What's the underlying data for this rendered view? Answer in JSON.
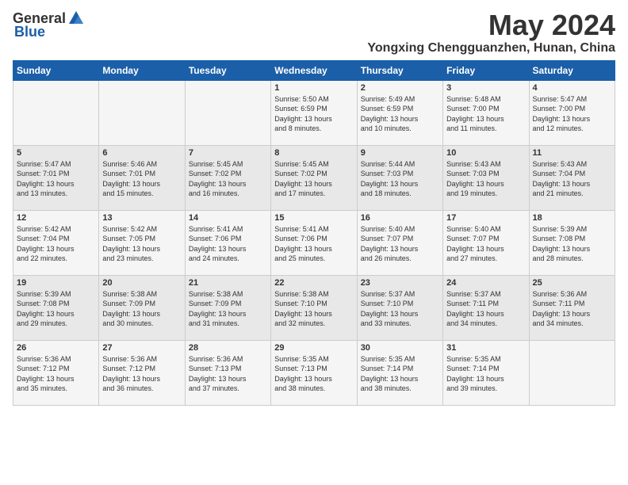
{
  "header": {
    "logo_general": "General",
    "logo_blue": "Blue",
    "month_year": "May 2024",
    "location": "Yongxing Chengguanzhen, Hunan, China"
  },
  "days_of_week": [
    "Sunday",
    "Monday",
    "Tuesday",
    "Wednesday",
    "Thursday",
    "Friday",
    "Saturday"
  ],
  "weeks": [
    {
      "cells": [
        {
          "day": "",
          "info": ""
        },
        {
          "day": "",
          "info": ""
        },
        {
          "day": "",
          "info": ""
        },
        {
          "day": "1",
          "info": "Sunrise: 5:50 AM\nSunset: 6:59 PM\nDaylight: 13 hours\nand 8 minutes."
        },
        {
          "day": "2",
          "info": "Sunrise: 5:49 AM\nSunset: 6:59 PM\nDaylight: 13 hours\nand 10 minutes."
        },
        {
          "day": "3",
          "info": "Sunrise: 5:48 AM\nSunset: 7:00 PM\nDaylight: 13 hours\nand 11 minutes."
        },
        {
          "day": "4",
          "info": "Sunrise: 5:47 AM\nSunset: 7:00 PM\nDaylight: 13 hours\nand 12 minutes."
        }
      ]
    },
    {
      "cells": [
        {
          "day": "5",
          "info": "Sunrise: 5:47 AM\nSunset: 7:01 PM\nDaylight: 13 hours\nand 13 minutes."
        },
        {
          "day": "6",
          "info": "Sunrise: 5:46 AM\nSunset: 7:01 PM\nDaylight: 13 hours\nand 15 minutes."
        },
        {
          "day": "7",
          "info": "Sunrise: 5:45 AM\nSunset: 7:02 PM\nDaylight: 13 hours\nand 16 minutes."
        },
        {
          "day": "8",
          "info": "Sunrise: 5:45 AM\nSunset: 7:02 PM\nDaylight: 13 hours\nand 17 minutes."
        },
        {
          "day": "9",
          "info": "Sunrise: 5:44 AM\nSunset: 7:03 PM\nDaylight: 13 hours\nand 18 minutes."
        },
        {
          "day": "10",
          "info": "Sunrise: 5:43 AM\nSunset: 7:03 PM\nDaylight: 13 hours\nand 19 minutes."
        },
        {
          "day": "11",
          "info": "Sunrise: 5:43 AM\nSunset: 7:04 PM\nDaylight: 13 hours\nand 21 minutes."
        }
      ]
    },
    {
      "cells": [
        {
          "day": "12",
          "info": "Sunrise: 5:42 AM\nSunset: 7:04 PM\nDaylight: 13 hours\nand 22 minutes."
        },
        {
          "day": "13",
          "info": "Sunrise: 5:42 AM\nSunset: 7:05 PM\nDaylight: 13 hours\nand 23 minutes."
        },
        {
          "day": "14",
          "info": "Sunrise: 5:41 AM\nSunset: 7:06 PM\nDaylight: 13 hours\nand 24 minutes."
        },
        {
          "day": "15",
          "info": "Sunrise: 5:41 AM\nSunset: 7:06 PM\nDaylight: 13 hours\nand 25 minutes."
        },
        {
          "day": "16",
          "info": "Sunrise: 5:40 AM\nSunset: 7:07 PM\nDaylight: 13 hours\nand 26 minutes."
        },
        {
          "day": "17",
          "info": "Sunrise: 5:40 AM\nSunset: 7:07 PM\nDaylight: 13 hours\nand 27 minutes."
        },
        {
          "day": "18",
          "info": "Sunrise: 5:39 AM\nSunset: 7:08 PM\nDaylight: 13 hours\nand 28 minutes."
        }
      ]
    },
    {
      "cells": [
        {
          "day": "19",
          "info": "Sunrise: 5:39 AM\nSunset: 7:08 PM\nDaylight: 13 hours\nand 29 minutes."
        },
        {
          "day": "20",
          "info": "Sunrise: 5:38 AM\nSunset: 7:09 PM\nDaylight: 13 hours\nand 30 minutes."
        },
        {
          "day": "21",
          "info": "Sunrise: 5:38 AM\nSunset: 7:09 PM\nDaylight: 13 hours\nand 31 minutes."
        },
        {
          "day": "22",
          "info": "Sunrise: 5:38 AM\nSunset: 7:10 PM\nDaylight: 13 hours\nand 32 minutes."
        },
        {
          "day": "23",
          "info": "Sunrise: 5:37 AM\nSunset: 7:10 PM\nDaylight: 13 hours\nand 33 minutes."
        },
        {
          "day": "24",
          "info": "Sunrise: 5:37 AM\nSunset: 7:11 PM\nDaylight: 13 hours\nand 34 minutes."
        },
        {
          "day": "25",
          "info": "Sunrise: 5:36 AM\nSunset: 7:11 PM\nDaylight: 13 hours\nand 34 minutes."
        }
      ]
    },
    {
      "cells": [
        {
          "day": "26",
          "info": "Sunrise: 5:36 AM\nSunset: 7:12 PM\nDaylight: 13 hours\nand 35 minutes."
        },
        {
          "day": "27",
          "info": "Sunrise: 5:36 AM\nSunset: 7:12 PM\nDaylight: 13 hours\nand 36 minutes."
        },
        {
          "day": "28",
          "info": "Sunrise: 5:36 AM\nSunset: 7:13 PM\nDaylight: 13 hours\nand 37 minutes."
        },
        {
          "day": "29",
          "info": "Sunrise: 5:35 AM\nSunset: 7:13 PM\nDaylight: 13 hours\nand 38 minutes."
        },
        {
          "day": "30",
          "info": "Sunrise: 5:35 AM\nSunset: 7:14 PM\nDaylight: 13 hours\nand 38 minutes."
        },
        {
          "day": "31",
          "info": "Sunrise: 5:35 AM\nSunset: 7:14 PM\nDaylight: 13 hours\nand 39 minutes."
        },
        {
          "day": "",
          "info": ""
        }
      ]
    }
  ]
}
